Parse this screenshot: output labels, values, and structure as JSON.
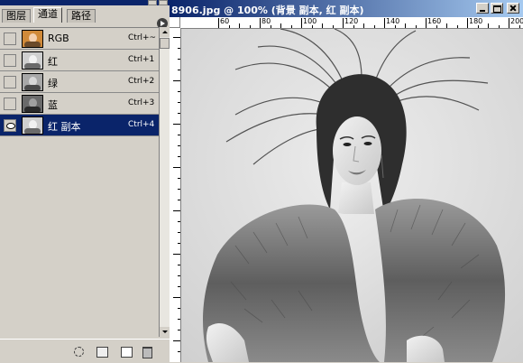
{
  "panel": {
    "tabs": [
      "图层",
      "通道",
      "路径"
    ],
    "active_tab": 1,
    "channels": [
      {
        "name": "RGB",
        "shortcut": "Ctrl+~",
        "visible": false,
        "selected": false,
        "thumb": "color"
      },
      {
        "name": "红",
        "shortcut": "Ctrl+1",
        "visible": false,
        "selected": false,
        "thumb": "gray-light"
      },
      {
        "name": "绿",
        "shortcut": "Ctrl+2",
        "visible": false,
        "selected": false,
        "thumb": "gray-mid"
      },
      {
        "name": "蓝",
        "shortcut": "Ctrl+3",
        "visible": false,
        "selected": false,
        "thumb": "gray-dark"
      },
      {
        "name": "红 副本",
        "shortcut": "Ctrl+4",
        "visible": true,
        "selected": true,
        "thumb": "gray-light"
      }
    ],
    "bottom_icons": [
      "dotted-circle-icon",
      "mask-icon",
      "new-channel-icon",
      "trash-icon"
    ]
  },
  "document": {
    "title": "8906.jpg @ 100% (背景 副本, 红 副本)",
    "ruler_labels": [
      "60",
      "80",
      "100",
      "120",
      "140",
      "160",
      "180",
      "200"
    ]
  },
  "colors": {
    "selection": "#0a246a",
    "panel_bg": "#d4d0c8"
  }
}
